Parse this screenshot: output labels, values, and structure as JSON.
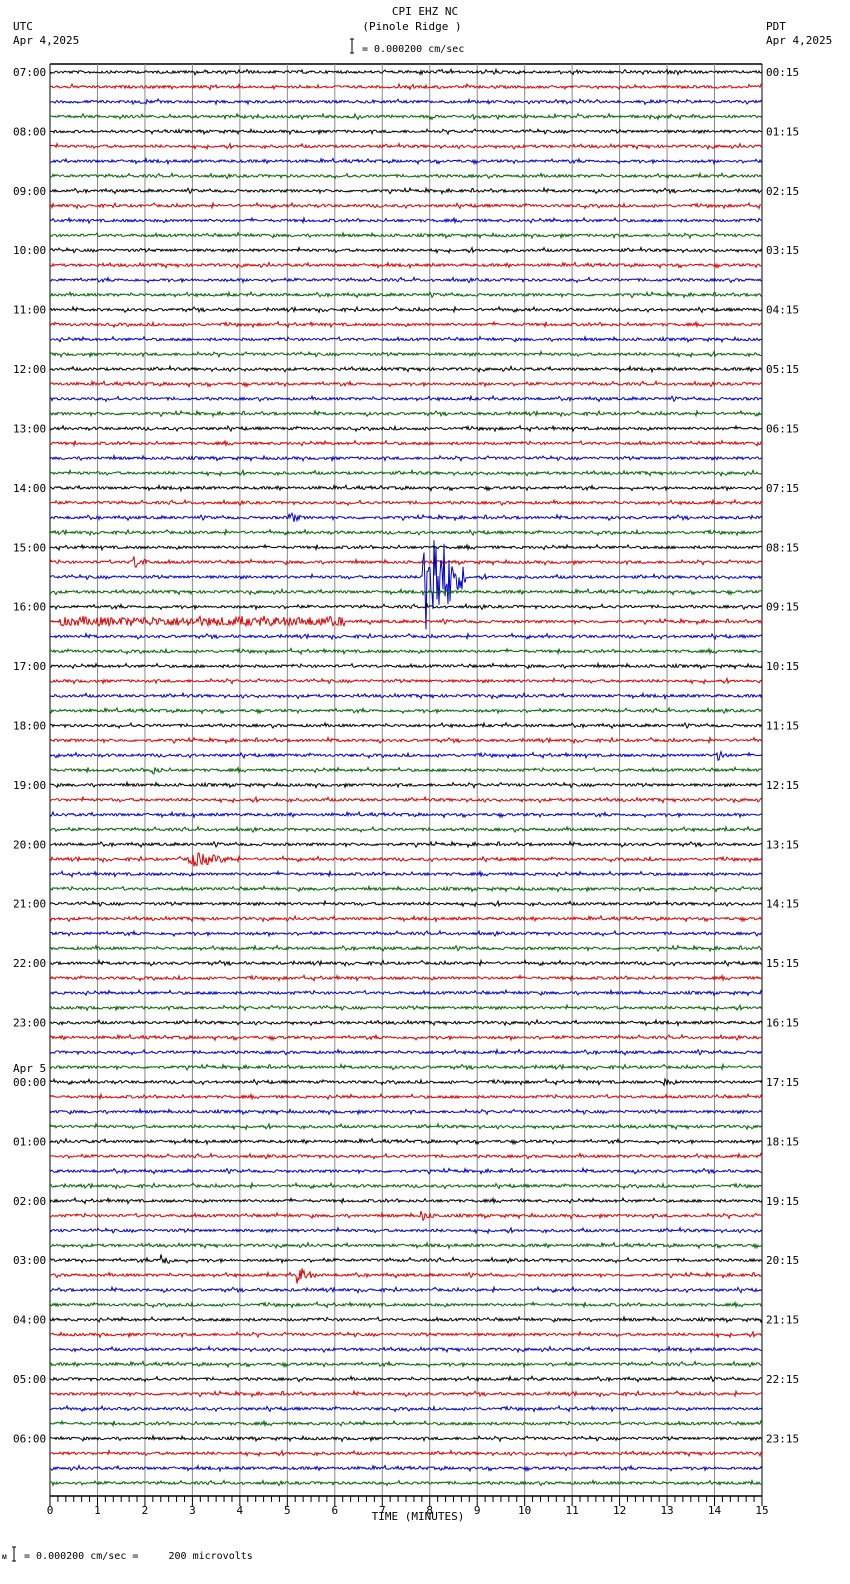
{
  "chart_data": {
    "type": "line",
    "title": "CPI EHZ NC",
    "subtitle": "(Pinole Ridge )",
    "left_tz": "UTC",
    "left_date": "Apr 4,2025",
    "right_tz": "PDT",
    "right_date": "Apr 4,2025",
    "scale_label": "= 0.000200 cm/sec",
    "footer_scale": "= 0.000200 cm/sec =     200 microvolts",
    "xlabel": "TIME (MINUTES)",
    "xlim": [
      0,
      15
    ],
    "x_ticks": [
      "0",
      "1",
      "2",
      "3",
      "4",
      "5",
      "6",
      "7",
      "8",
      "9",
      "10",
      "11",
      "12",
      "13",
      "14",
      "15"
    ],
    "traces_per_hour": 4,
    "trace_colors": [
      "#000000",
      "#dd0000",
      "#0000cc",
      "#006600"
    ],
    "left_labels": [
      "07:00",
      "08:00",
      "09:00",
      "10:00",
      "11:00",
      "12:00",
      "13:00",
      "14:00",
      "15:00",
      "16:00",
      "17:00",
      "18:00",
      "19:00",
      "20:00",
      "21:00",
      "22:00",
      "23:00",
      "00:00",
      "01:00",
      "02:00",
      "03:00",
      "04:00",
      "05:00",
      "06:00"
    ],
    "date_change_label": "Apr 5",
    "date_change_index": 17,
    "right_labels": [
      "00:15",
      "01:15",
      "02:15",
      "03:15",
      "04:15",
      "05:15",
      "06:15",
      "07:15",
      "08:15",
      "09:15",
      "10:15",
      "11:15",
      "12:15",
      "13:15",
      "14:15",
      "15:15",
      "16:15",
      "17:15",
      "18:15",
      "19:15",
      "20:15",
      "21:15",
      "22:15",
      "23:15"
    ],
    "events": [
      {
        "trace": 30,
        "minute": 5.0,
        "amp": 6,
        "dur": 0.3
      },
      {
        "trace": 33,
        "minute": 1.7,
        "amp": 7,
        "dur": 0.4
      },
      {
        "trace": 34,
        "minute": 7.85,
        "amp": 70,
        "dur": 0.9
      },
      {
        "trace": 37,
        "minute": 0.2,
        "amp": 4,
        "dur": 6.0
      },
      {
        "trace": 46,
        "minute": 14.0,
        "amp": 6,
        "dur": 0.3
      },
      {
        "trace": 47,
        "minute": 2.1,
        "amp": 4,
        "dur": 0.3
      },
      {
        "trace": 53,
        "minute": 2.9,
        "amp": 7,
        "dur": 1.0
      },
      {
        "trace": 68,
        "minute": 12.9,
        "amp": 3,
        "dur": 0.3
      },
      {
        "trace": 77,
        "minute": 7.8,
        "amp": 5,
        "dur": 0.3
      },
      {
        "trace": 80,
        "minute": 2.3,
        "amp": 9,
        "dur": 0.3
      },
      {
        "trace": 81,
        "minute": 5.2,
        "amp": 8,
        "dur": 0.4
      }
    ]
  }
}
